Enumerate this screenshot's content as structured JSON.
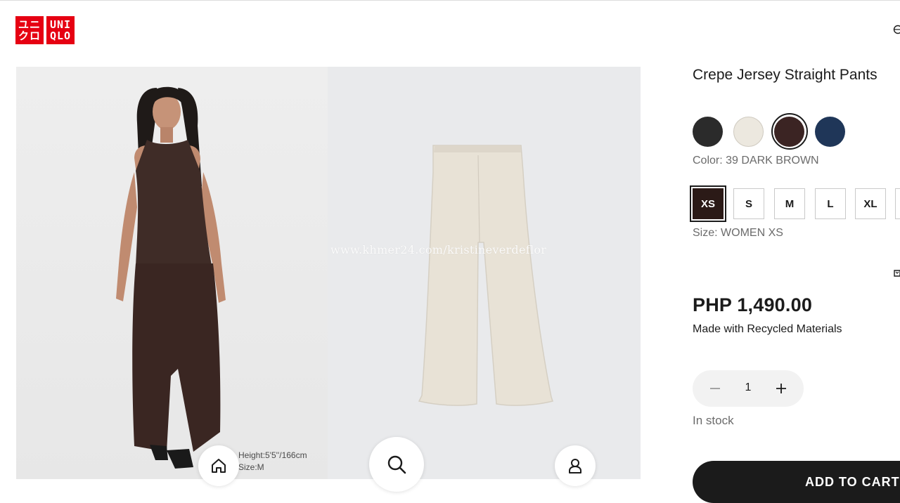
{
  "brand": {
    "logo_katakana": [
      "ユニ",
      "クロ"
    ],
    "logo_latin": [
      "UNI",
      "QLO"
    ],
    "color": "#e60012"
  },
  "gallery": {
    "watermark": "www.khmer24.com/kristineverdeflor",
    "model_height": "Height:5'5''/166cm",
    "model_size": "Size:M"
  },
  "product": {
    "title": "Crepe Jersey Straight Pants",
    "colors": [
      {
        "name": "black",
        "hex": "#2b2b2b"
      },
      {
        "name": "off-white",
        "hex": "#ece8df"
      },
      {
        "name": "dark-brown",
        "hex": "#3b2423"
      },
      {
        "name": "navy",
        "hex": "#1f3658"
      }
    ],
    "selected_color_label": "Color: 39 DARK BROWN",
    "sizes": [
      "XS",
      "S",
      "M",
      "L",
      "XL"
    ],
    "selected_size": "XS",
    "selected_size_label": "Size: WOMEN XS",
    "price": "PHP 1,490.00",
    "note": "Made with Recycled Materials",
    "quantity": "1",
    "stock": "In stock",
    "add_to_cart": "ADD TO CART"
  },
  "icons": {
    "home": "home-icon",
    "search": "search-icon",
    "account": "account-icon",
    "globe": "globe-icon",
    "minus": "minus-icon",
    "plus": "plus-icon"
  }
}
